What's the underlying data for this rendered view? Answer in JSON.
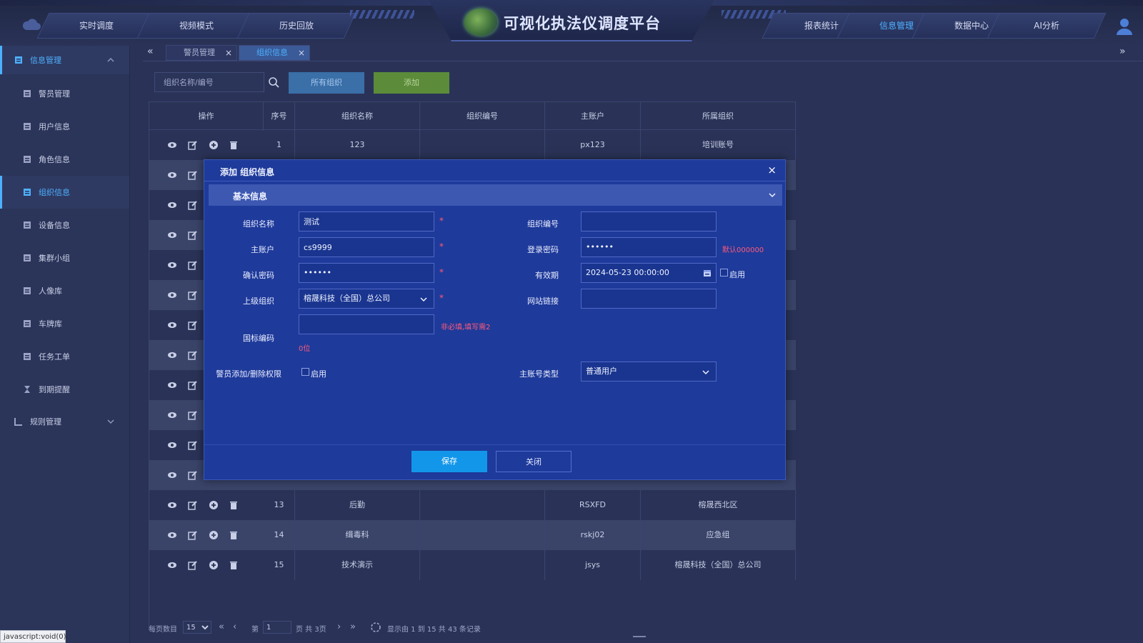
{
  "app": {
    "title": "可视化执法仪调度平台"
  },
  "nav": {
    "left": [
      "实时调度",
      "视频模式",
      "历史回放"
    ],
    "right": [
      "报表统计",
      "信息管理",
      "数据中心",
      "AI分析"
    ],
    "active": "信息管理"
  },
  "sidebar": {
    "group_main": "信息管理",
    "items": [
      "警员管理",
      "用户信息",
      "角色信息",
      "组织信息",
      "设备信息",
      "集群小组",
      "人像库",
      "车牌库",
      "任务工单",
      "到期提醒"
    ],
    "active_item": "组织信息",
    "group_rules": "规则管理"
  },
  "tabs": [
    {
      "label": "警员管理",
      "close": "×"
    },
    {
      "label": "组织信息",
      "close": "×"
    }
  ],
  "toolbar": {
    "search_placeholder": "组织名称/编号",
    "all_orgs_label": "所有组织",
    "add_label": "添加"
  },
  "table": {
    "headers": [
      "操作",
      "序号",
      "组织名称",
      "组织编号",
      "主账户",
      "所属组织"
    ],
    "rows": [
      {
        "no": "1",
        "name": "123",
        "code": "",
        "account": "px123",
        "parent": "培训账号"
      },
      {
        "no": "13",
        "name": "后勤",
        "code": "",
        "account": "RSXFD",
        "parent": "榕晟西北区"
      },
      {
        "no": "14",
        "name": "缉毒科",
        "code": "",
        "account": "rskj02",
        "parent": "应急组"
      },
      {
        "no": "15",
        "name": "技术演示",
        "code": "",
        "account": "jsys",
        "parent": "榕晟科技（全国）总公司"
      }
    ]
  },
  "pager": {
    "per_page_label": "每页数目",
    "per_page_value": "15",
    "page_prefix": "第",
    "page_value": "1",
    "page_suffix": "页 共 3页",
    "summary": "显示由 1 到 15 共 43 条记录"
  },
  "status_bar": "javascript:void(0);",
  "modal": {
    "title": "添加   组织信息",
    "close": "×",
    "section": "基本信息",
    "labels": {
      "org_name": "组织名称",
      "org_code": "组织编号",
      "main_account": "主账户",
      "login_password": "登录密码",
      "confirm_password": "确认密码",
      "validity": "有效期",
      "parent_org": "上级组织",
      "website": "网站链接",
      "national_code": "国标编码",
      "officer_perm": "警员添加/删除权限",
      "account_type": "主账号类型"
    },
    "values": {
      "org_name": "测试",
      "org_code": "",
      "main_account": "cs9999",
      "login_password": "••••••",
      "confirm_password": "••••••",
      "validity": "2024-05-23 00:00:00",
      "parent_org": "榕晟科技（全国）总公司",
      "website": "",
      "national_code": "",
      "account_type": "普通用户"
    },
    "required_mark": "*",
    "password_hint": "默认000000",
    "national_hint_1": "非必填,填写需2",
    "national_hint_2": "0位",
    "enable_label": "启用",
    "save_label": "保存",
    "close_label": "关闭"
  },
  "colors": {
    "page_bg": "#2a3357",
    "modal_bg": "#1e3a9a",
    "accent": "#4db1ff",
    "save_button": "#1296ea",
    "add_button": "#5c8c3a",
    "required": "#ff5a7a"
  }
}
